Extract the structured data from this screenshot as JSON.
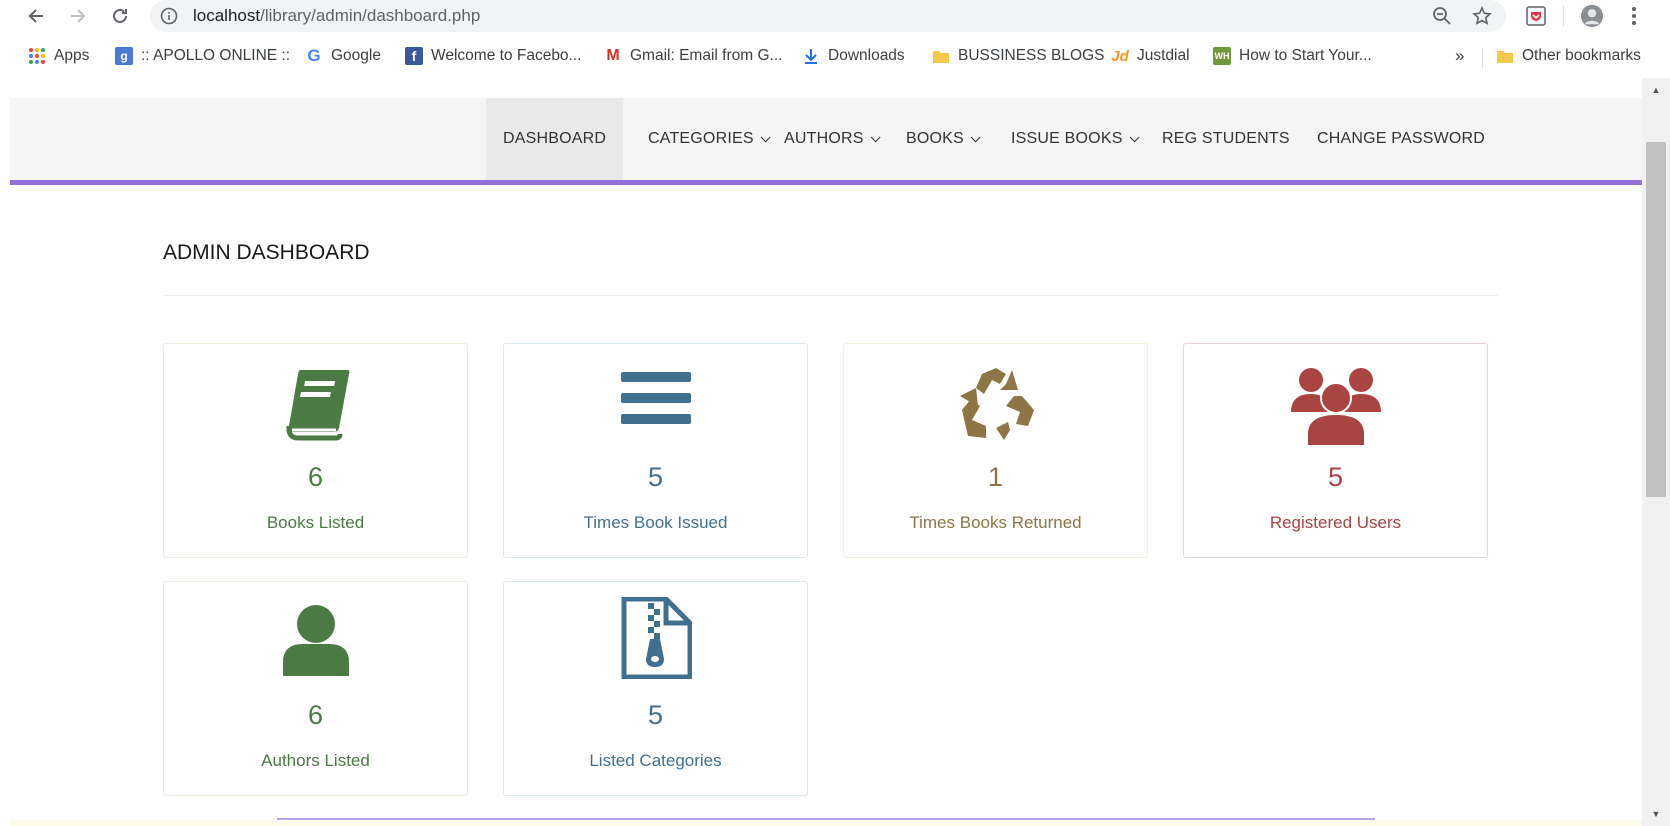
{
  "browser": {
    "url_host": "localhost",
    "url_path": "/library/admin/dashboard.php",
    "bookmarks": [
      {
        "label": "Apps",
        "icon": "apps-grid-icon"
      },
      {
        "label": ":: APOLLO ONLINE ::",
        "icon": "google-plus-icon"
      },
      {
        "label": "Google",
        "icon": "google-icon"
      },
      {
        "label": "Welcome to Facebo...",
        "icon": "facebook-icon"
      },
      {
        "label": "Gmail: Email from G...",
        "icon": "gmail-icon"
      },
      {
        "label": "Downloads",
        "icon": "download-icon"
      },
      {
        "label": "BUSSINESS BLOGS",
        "icon": "folder-icon"
      },
      {
        "label": "Justdial",
        "icon": "justdial-icon"
      },
      {
        "label": "How to Start Your...",
        "icon": "wh-icon"
      }
    ],
    "overflow_label": "»",
    "other_bookmarks": "Other bookmarks"
  },
  "menu": {
    "items": [
      {
        "label": "DASHBOARD",
        "active": true,
        "dropdown": false
      },
      {
        "label": "CATEGORIES",
        "dropdown": true
      },
      {
        "label": "AUTHORS",
        "dropdown": true
      },
      {
        "label": "BOOKS",
        "dropdown": true
      },
      {
        "label": "ISSUE BOOKS",
        "dropdown": true
      },
      {
        "label": "REG STUDENTS",
        "dropdown": false
      },
      {
        "label": "CHANGE PASSWORD",
        "dropdown": false
      }
    ]
  },
  "page": {
    "title": "ADMIN DASHBOARD"
  },
  "cards": [
    {
      "count": "6",
      "label": "Books Listed",
      "icon": "book-icon",
      "color": "#4c7a45",
      "border": "#efefdf"
    },
    {
      "count": "5",
      "label": "Times Book Issued",
      "icon": "bars-icon",
      "color": "#41708f",
      "border": "#d7ecf3"
    },
    {
      "count": "1",
      "label": "Times Books Returned",
      "icon": "recycle-icon",
      "color": "#8d7546",
      "border": "#f7f1dc"
    },
    {
      "count": "5",
      "label": "Registered Users",
      "icon": "users-icon",
      "color": "#a94442",
      "border": "#ebd2d9"
    },
    {
      "count": "6",
      "label": "Authors Listed",
      "icon": "user-icon",
      "color": "#4c7a45",
      "border": "#efefdf"
    },
    {
      "count": "5",
      "label": "Listed Categories",
      "icon": "file-zip-icon",
      "color": "#41708f",
      "border": "#d7ecf3"
    }
  ]
}
